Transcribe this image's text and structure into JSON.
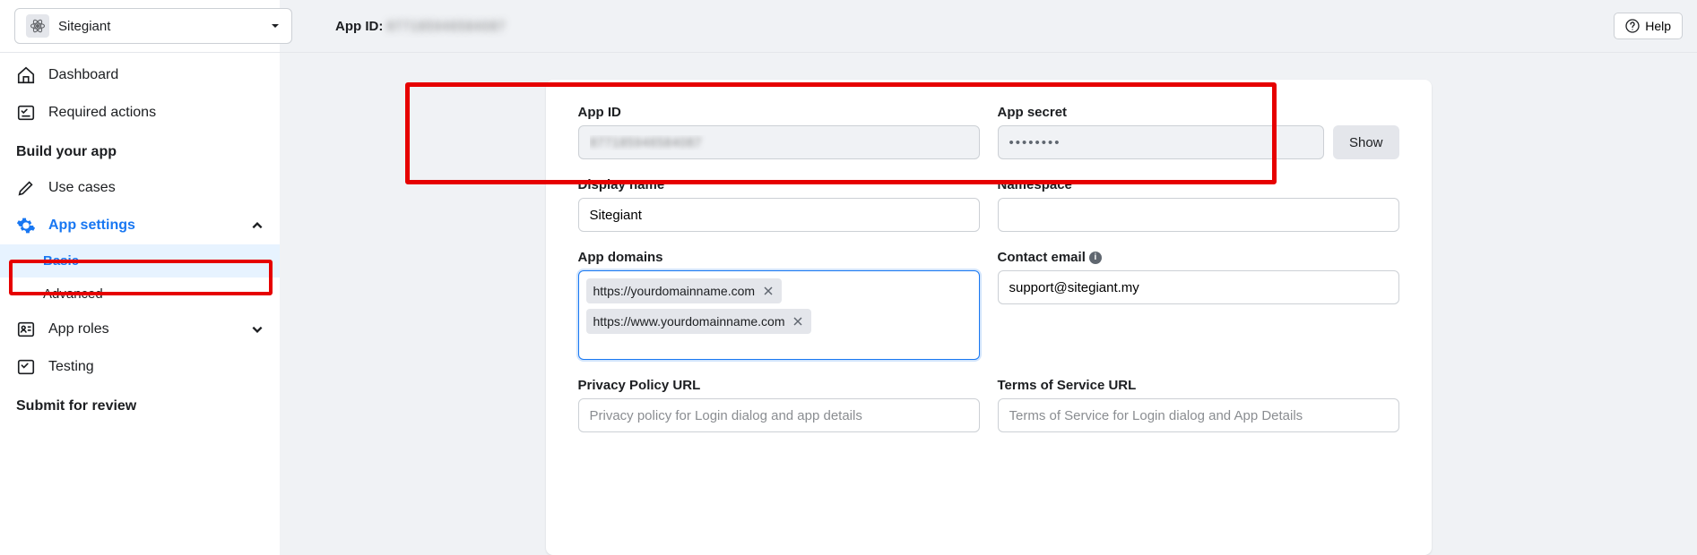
{
  "header": {
    "app_name": "Sitegiant",
    "app_id_label": "App ID:",
    "app_id_value": "877185946584087",
    "help_label": "Help"
  },
  "sidebar": {
    "items": [
      {
        "label": "Dashboard",
        "icon": "home"
      },
      {
        "label": "Required actions",
        "icon": "checklist"
      }
    ],
    "build_heading": "Build your app",
    "build_items": [
      {
        "label": "Use cases",
        "icon": "pencil"
      },
      {
        "label": "App settings",
        "icon": "gear",
        "active": true,
        "expanded": true,
        "children": [
          {
            "label": "Basic",
            "selected": true
          },
          {
            "label": "Advanced",
            "selected": false
          }
        ]
      },
      {
        "label": "App roles",
        "icon": "roles",
        "expandable": true
      },
      {
        "label": "Testing",
        "icon": "testing"
      }
    ],
    "submit_heading": "Submit for review"
  },
  "form": {
    "app_id": {
      "label": "App ID",
      "value": "877185946584087"
    },
    "app_secret": {
      "label": "App secret",
      "value": "••••••••",
      "show_label": "Show"
    },
    "display_name": {
      "label": "Display name",
      "value": "Sitegiant"
    },
    "namespace": {
      "label": "Namespace",
      "value": ""
    },
    "app_domains": {
      "label": "App domains",
      "tags": [
        "https://yourdomainname.com",
        "https://www.yourdomainname.com"
      ]
    },
    "contact_email": {
      "label": "Contact email",
      "value": "support@sitegiant.my"
    },
    "privacy_url": {
      "label": "Privacy Policy URL",
      "placeholder": "Privacy policy for Login dialog and app details"
    },
    "tos_url": {
      "label": "Terms of Service URL",
      "placeholder": "Terms of Service for Login dialog and App Details"
    }
  }
}
